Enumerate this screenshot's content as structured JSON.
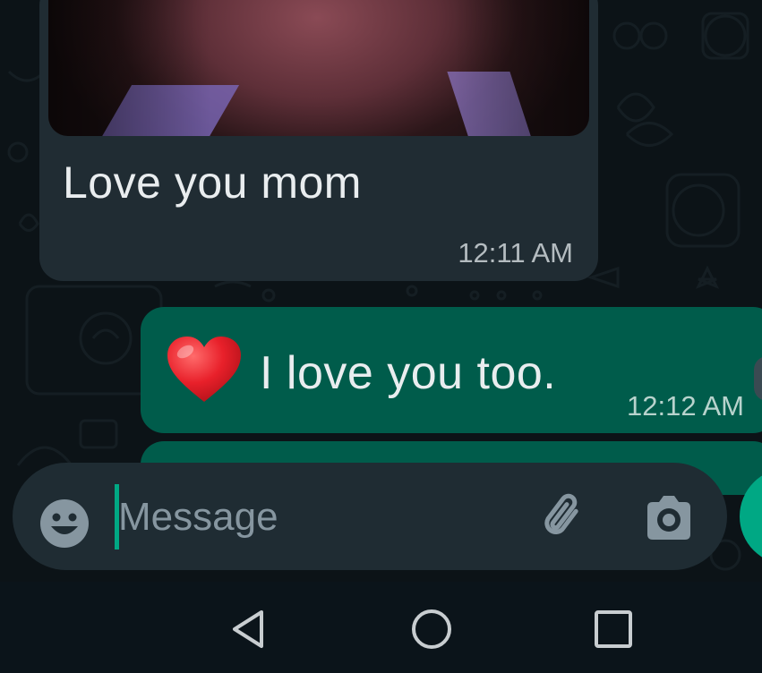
{
  "conversation": {
    "messages": [
      {
        "direction": "incoming",
        "has_photo": true,
        "text": "Love you mom",
        "time": "12:11 AM"
      },
      {
        "direction": "outgoing",
        "emoji": "heart",
        "text": "I love you too.",
        "time": "12:12 AM"
      }
    ]
  },
  "composer": {
    "placeholder": "Message",
    "value": "",
    "emoji_icon": "emoji-smiley-icon",
    "attach_icon": "paperclip-icon",
    "camera_icon": "camera-icon",
    "send_icon": "mic-icon"
  },
  "navigation": {
    "buttons": [
      "back-triangle-icon",
      "home-circle-icon",
      "recents-square-icon"
    ]
  },
  "colors": {
    "background": "#0c1317",
    "incoming_bubble": "#202c33",
    "outgoing_bubble": "#005c4b",
    "accent": "#00a884",
    "text": "#e9edef",
    "secondary_text": "#8696a0"
  }
}
